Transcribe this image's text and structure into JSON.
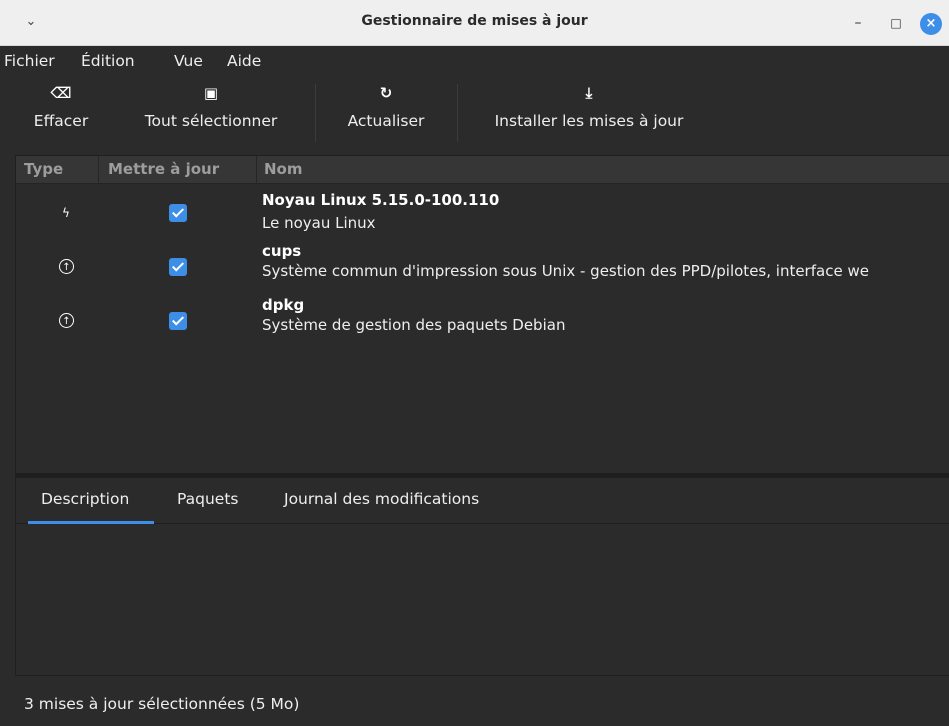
{
  "window": {
    "title": "Gestionnaire de mises à jour",
    "menu_icon": "chevron-down-icon",
    "minimize_glyph": "–",
    "maximize_glyph": "□",
    "close_glyph": "×"
  },
  "menubar": {
    "items": [
      "Fichier",
      "Édition",
      "Vue",
      "Aide"
    ]
  },
  "toolbar": {
    "clear": {
      "label": "Effacer",
      "icon": "backspace-icon",
      "glyph": "⌫"
    },
    "select_all": {
      "label": "Tout sélectionner",
      "icon": "select-all-icon",
      "glyph": "▣"
    },
    "refresh": {
      "label": "Actualiser",
      "icon": "refresh-icon",
      "glyph": "↻"
    },
    "install": {
      "label": "Installer les mises à jour",
      "icon": "download-icon",
      "glyph": "⤓"
    }
  },
  "list": {
    "columns": [
      "Type",
      "Mettre à jour",
      "Nom"
    ],
    "rows": [
      {
        "type_icon": "kernel-bolt-icon",
        "type_glyph": "ϟ",
        "checked": true,
        "name": "Noyau Linux 5.15.0-100.110",
        "description": "Le noyau Linux"
      },
      {
        "type_icon": "upgrade-arrow-icon",
        "type_glyph": "↑",
        "checked": true,
        "name": "cups",
        "description": "Système commun d'impression sous Unix - gestion des PPD/pilotes, interface we"
      },
      {
        "type_icon": "upgrade-arrow-icon",
        "type_glyph": "↑",
        "checked": true,
        "name": "dpkg",
        "description": "Système de gestion des paquets Debian"
      }
    ]
  },
  "details": {
    "tabs": [
      "Description",
      "Paquets",
      "Journal des modifications"
    ],
    "active_tab": "Description"
  },
  "status": {
    "text": "3 mises à jour sélectionnées (5 Mo)"
  },
  "colors": {
    "accent": "#3d8ee6",
    "background": "#2b2b2b",
    "titlebar": "#efefef"
  }
}
